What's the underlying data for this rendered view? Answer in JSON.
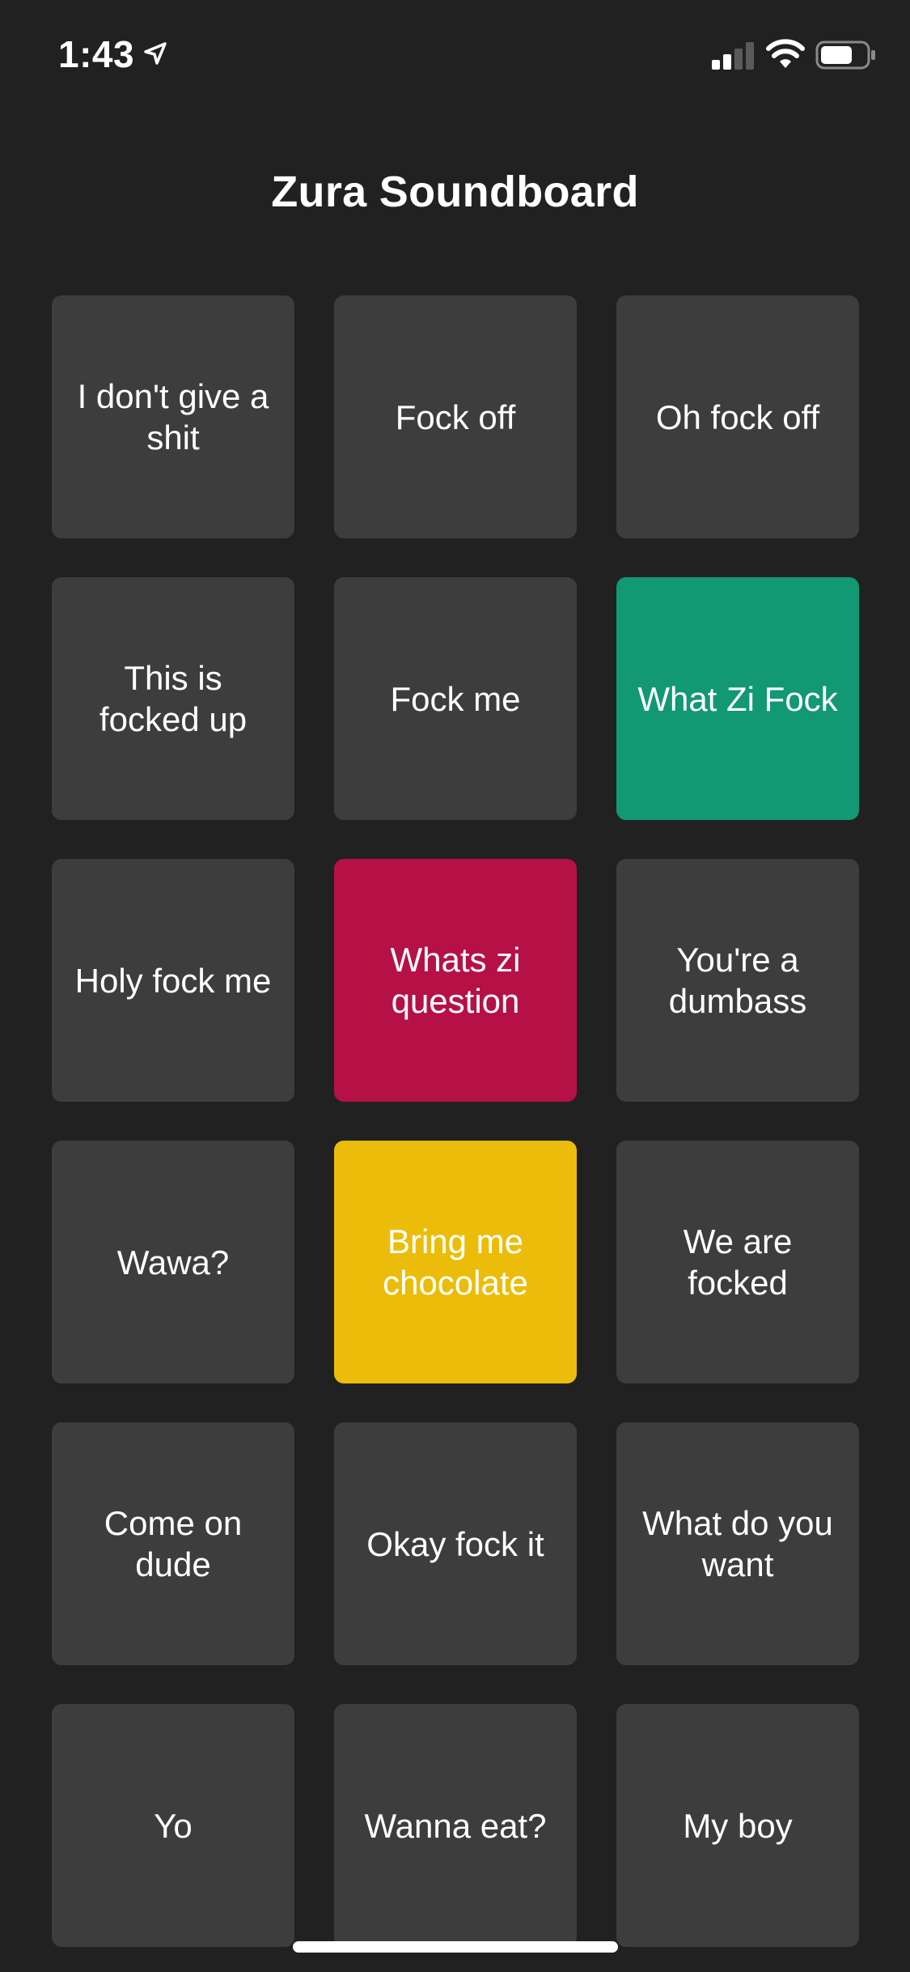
{
  "status_bar": {
    "time": "1:43",
    "icons": [
      "location-arrow-icon",
      "cellular-signal-icon",
      "wifi-icon",
      "battery-icon"
    ]
  },
  "header": {
    "title": "Zura Soundboard"
  },
  "buttons": [
    {
      "label": "I don't give a shit",
      "color": "#3d3d3d"
    },
    {
      "label": "Fock off",
      "color": "#3d3d3d"
    },
    {
      "label": "Oh fock off",
      "color": "#3d3d3d"
    },
    {
      "label": "This is focked up",
      "color": "#3d3d3d"
    },
    {
      "label": "Fock me",
      "color": "#3d3d3d"
    },
    {
      "label": "What Zi Fock",
      "color": "#129873"
    },
    {
      "label": "Holy fock me",
      "color": "#3d3d3d"
    },
    {
      "label": "Whats zi question",
      "color": "#b51146"
    },
    {
      "label": "You're a dumbass",
      "color": "#3d3d3d"
    },
    {
      "label": "Wawa?",
      "color": "#3d3d3d"
    },
    {
      "label": "Bring me chocolate",
      "color": "#ebbd0a"
    },
    {
      "label": "We are focked",
      "color": "#3d3d3d"
    },
    {
      "label": "Come on dude",
      "color": "#3d3d3d"
    },
    {
      "label": "Okay fock it",
      "color": "#3d3d3d"
    },
    {
      "label": "What do you want",
      "color": "#3d3d3d"
    },
    {
      "label": "Yo",
      "color": "#3d3d3d"
    },
    {
      "label": "Wanna eat?",
      "color": "#3d3d3d"
    },
    {
      "label": "My boy",
      "color": "#3d3d3d"
    }
  ],
  "colors": {
    "background": "#212121",
    "button_default": "#3d3d3d",
    "text": "#ffffff"
  }
}
